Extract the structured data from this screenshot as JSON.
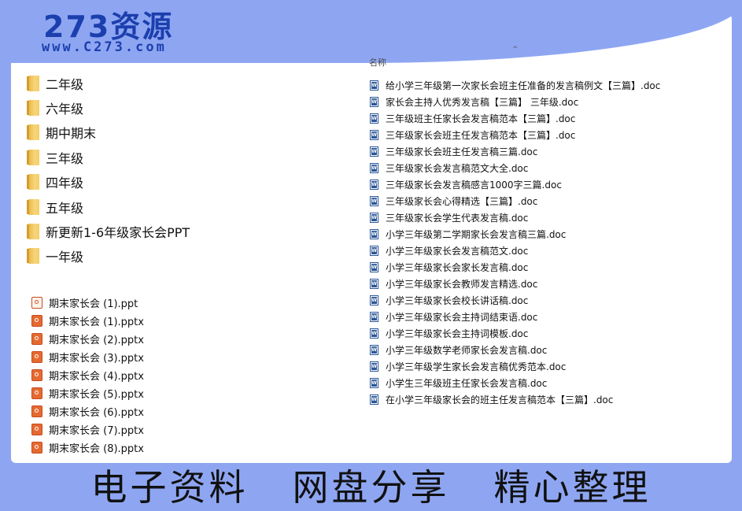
{
  "brand": {
    "title": "273资源",
    "url": "www.C273.com"
  },
  "column_header": "名称",
  "folders": [
    "二年级",
    "六年级",
    "期中期末",
    "三年级",
    "四年级",
    "五年级",
    "新更新1-6年级家长会PPT",
    "一年级"
  ],
  "ppt_files": [
    {
      "name": "期末家长会 (1).ppt",
      "type": "ppt"
    },
    {
      "name": "期末家长会 (1).pptx",
      "type": "pptx"
    },
    {
      "name": "期末家长会 (2).pptx",
      "type": "pptx"
    },
    {
      "name": "期末家长会 (3).pptx",
      "type": "pptx"
    },
    {
      "name": "期末家长会 (4).pptx",
      "type": "pptx"
    },
    {
      "name": "期末家长会 (5).pptx",
      "type": "pptx"
    },
    {
      "name": "期末家长会 (6).pptx",
      "type": "pptx"
    },
    {
      "name": "期末家长会 (7).pptx",
      "type": "pptx"
    },
    {
      "name": "期末家长会 (8).pptx",
      "type": "pptx"
    }
  ],
  "doc_files": [
    "给小学三年级第一次家长会班主任准备的发言稿例文【三篇】.doc",
    "家长会主持人优秀发言稿【三篇】 三年级.doc",
    "三年级班主任家长会发言稿范本【三篇】.doc",
    "三年级家长会班主任发言稿范本【三篇】.doc",
    "三年级家长会班主任发言稿三篇.doc",
    "三年级家长会发言稿范文大全.doc",
    "三年级家长会发言稿感言1000字三篇.doc",
    "三年级家长会心得精选【三篇】.doc",
    "三年级家长会学生代表发言稿.doc",
    "小学三年级第二学期家长会发言稿三篇.doc",
    "小学三年级家长会发言稿范文.doc",
    "小学三年级家长会家长发言稿.doc",
    "小学三年级家长会教师发言精选.doc",
    "小学三年级家长会校长讲话稿.doc",
    "小学三年级家长会主持词结束语.doc",
    "小学三年级家长会主持词模板.doc",
    "小学三年级数学老师家长会发言稿.doc",
    "小学三年级学生家长会发言稿优秀范本.doc",
    "小学生三年级班主任家长会发言稿.doc",
    "在小学三年级家长会的班主任发言稿范本【三篇】.doc"
  ],
  "footer": [
    "电子资料",
    "网盘分享",
    "精心整理"
  ]
}
